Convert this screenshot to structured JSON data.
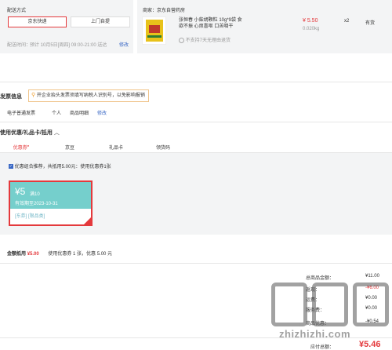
{
  "shipping": {
    "title": "配送方式",
    "options": [
      "京东快递",
      "上门自提"
    ],
    "time_label": "配送时间：",
    "time_value": "预计 10月5日[周四] 09:00-21:00 送达",
    "modify": "修改"
  },
  "seller": {
    "label": "商家：",
    "name": "京东自营药房"
  },
  "product": {
    "name": "张恒春 小柴胡颗粒 10g*9袋 食欲不振 心烦喜呕 口苦咽干",
    "price": "¥ 5.50",
    "weight": "0.020kg",
    "qty": "x2",
    "stock": "有货",
    "no_return": "不支持7天无理由退货"
  },
  "invoice": {
    "title": "发票信息",
    "tip": "开企业抬头发票须填写纳税人识别号，以免影响报销",
    "type": "电子普通发票",
    "header": "个人",
    "content": "商品明细",
    "modify": "修改"
  },
  "coupons": {
    "title": "使用优惠/礼品卡/抵用",
    "tabs": [
      "优惠券",
      "京豆",
      "礼品卡",
      "领货码"
    ],
    "combo_check": "优惠组合推荐，共抵用5.00元：使用优惠券1张",
    "card": {
      "amount": "¥5",
      "threshold": "满10",
      "expiry": "有效期至2023-10-31",
      "tags": "[东券] [限品类]"
    },
    "summary_label": "金额抵用",
    "summary_amount": "¥5.00",
    "summary_detail": "使用优惠券 1 张，优惠 5.00 元"
  },
  "totals": {
    "goods_label": "总商品金额：",
    "goods_value": "¥11.00",
    "row2_label": "返现：",
    "row2_value": "-¥6.00",
    "row3_label": "运费：",
    "row3_value": "¥0.00",
    "row4_label": "服务费：",
    "row4_value": "¥0.00",
    "row5_label": "商品优惠：",
    "row5_value": "-¥0.54",
    "payable_label": "应付总额：",
    "payable_value": "¥5.46"
  },
  "watermark": {
    "logo": "值 值 值",
    "site": "zhizhizhi.com"
  }
}
